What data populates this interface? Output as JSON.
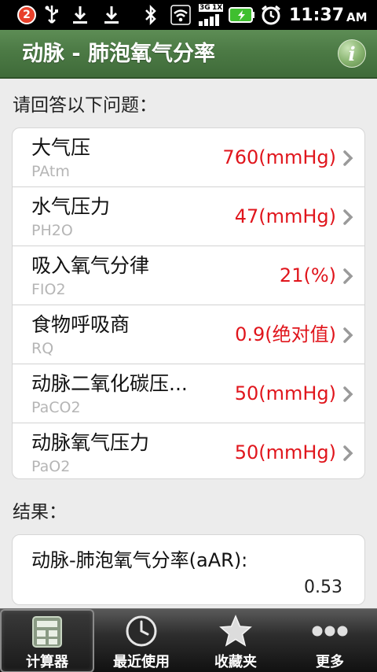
{
  "status_bar": {
    "notification_count": "2",
    "time": "11:37",
    "ampm": "AM",
    "network_label_top": "3G",
    "network_label_bottom": "1X",
    "icons": [
      "usb-icon",
      "download-icon",
      "download-icon",
      "bluetooth-icon",
      "wifi-icon",
      "signal-icon",
      "battery-icon",
      "alarm-icon"
    ]
  },
  "header": {
    "title": "动脉 - 肺泡氧气分率",
    "info_label": "i"
  },
  "questions": {
    "section_label": "请回答以下问题：",
    "items": [
      {
        "label": "大气压",
        "sub": "PAtm",
        "value": "760(mmHg)"
      },
      {
        "label": "水气压力",
        "sub": "PH2O",
        "value": "47(mmHg)"
      },
      {
        "label": "吸入氧气分律",
        "sub": "FIO2",
        "value": "21(%)"
      },
      {
        "label": "食物呼吸商",
        "sub": "RQ",
        "value": "0.9(绝对值)"
      },
      {
        "label": "动脉二氧化碳压...",
        "sub": "PaCO2",
        "value": "50(mmHg)"
      },
      {
        "label": "动脉氧气压力",
        "sub": "PaO2",
        "value": "50(mmHg)"
      }
    ]
  },
  "result": {
    "section_label": "结果：",
    "label": "动脉-肺泡氧气分率(aAR):",
    "value": "0.53"
  },
  "tabs": [
    {
      "label": "计算器",
      "icon": "calculator-icon",
      "active": true
    },
    {
      "label": "最近使用",
      "icon": "clock-icon",
      "active": false
    },
    {
      "label": "收藏夹",
      "icon": "star-icon",
      "active": false
    },
    {
      "label": "更多",
      "icon": "more-icon",
      "active": false
    }
  ],
  "colors": {
    "accent_green": "#4c7a45",
    "value_red": "#e0151c"
  }
}
